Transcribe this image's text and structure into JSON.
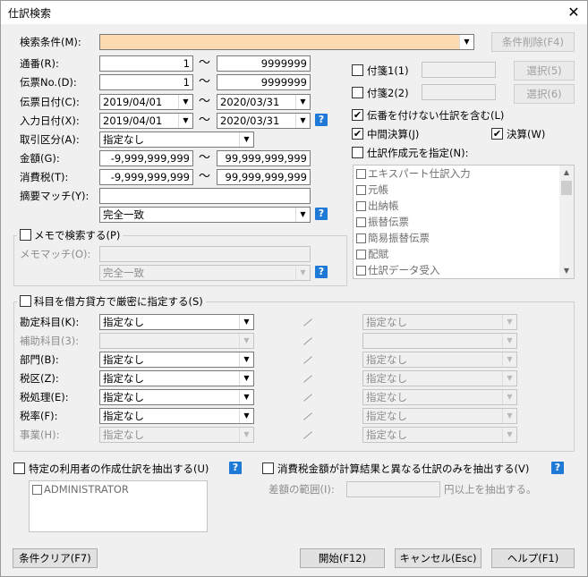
{
  "window": {
    "title": "仕訳検索"
  },
  "icons": {
    "close": "close-icon",
    "help": "help-icon",
    "dropdown": "chevron-down-icon"
  },
  "tilde": "～",
  "help_mark": "?",
  "check_mark": "✔",
  "search_condition": {
    "label": "検索条件(M):",
    "value": "",
    "accent": "#fddbb1"
  },
  "delete_condition_button": "条件削除(F4)",
  "serial": {
    "label": "通番(R):",
    "from": "1",
    "to": "9999999"
  },
  "voucher_no": {
    "label": "伝票No.(D):",
    "from": "1",
    "to": "9999999"
  },
  "voucher_date": {
    "label": "伝票日付(C):",
    "from": "2019/04/01",
    "to": "2020/03/31"
  },
  "input_date": {
    "label": "入力日付(X):",
    "from": "2019/04/01",
    "to": "2020/03/31"
  },
  "transaction_type": {
    "label": "取引区分(A):",
    "value": "指定なし"
  },
  "amount": {
    "label": "金額(G):",
    "from": "-9,999,999,999",
    "to": "99,999,999,999"
  },
  "tax": {
    "label": "消費税(T):",
    "from": "-9,999,999,999",
    "to": "99,999,999,999"
  },
  "summary_match": {
    "label": "摘要マッチ(Y):",
    "value": "",
    "mode": "完全一致"
  },
  "memo_search": {
    "label": "メモで検索する(P)",
    "match_label": "メモマッチ(O):",
    "value": "",
    "mode": "完全一致"
  },
  "sticky1": {
    "label": "付箋1(1)",
    "value": "",
    "select_button": "選択(5)"
  },
  "sticky2": {
    "label": "付箋2(2)",
    "value": "",
    "select_button": "選択(6)"
  },
  "include_unnumbered": {
    "label": "伝番を付けない仕訳を含む(L)",
    "checked": true
  },
  "interim_settlement": {
    "label": "中間決算(J)",
    "checked": true
  },
  "settlement": {
    "label": "決算(W)",
    "checked": true
  },
  "source": {
    "label": "仕訳作成元を指定(N):",
    "checked": false,
    "items": [
      "エキスパート仕訳入力",
      "元帳",
      "出納帳",
      "振替伝票",
      "簡易振替伝票",
      "配賦",
      "仕訳データ受入"
    ]
  },
  "strict_accounts": {
    "label": "科目を借方貸方で厳密に指定する(S)",
    "rows": [
      {
        "label": "勘定科目(K):",
        "debit": "指定なし",
        "credit": "指定なし",
        "enabled": true
      },
      {
        "label": "補助科目(3):",
        "debit": "",
        "credit": "",
        "enabled": false
      },
      {
        "label": "部門(B):",
        "debit": "指定なし",
        "credit": "指定なし",
        "enabled": true
      },
      {
        "label": "税区(Z):",
        "debit": "指定なし",
        "credit": "指定なし",
        "enabled": true
      },
      {
        "label": "税処理(E):",
        "debit": "指定なし",
        "credit": "指定なし",
        "enabled": true
      },
      {
        "label": "税率(F):",
        "debit": "指定なし",
        "credit": "指定なし",
        "enabled": true
      },
      {
        "label": "事業(H):",
        "debit": "指定なし",
        "credit": "指定なし",
        "enabled": false
      }
    ]
  },
  "specific_user": {
    "label": "特定の利用者の作成仕訳を抽出する(U)",
    "users": [
      "ADMINISTRATOR"
    ]
  },
  "tax_diff": {
    "label": "消費税金額が計算結果と異なる仕訳のみを抽出する(V)",
    "range_label": "差額の範囲(I):",
    "value": "",
    "suffix": "円以上を抽出する。"
  },
  "buttons": {
    "clear": "条件クリア(F7)",
    "start": "開始(F12)",
    "cancel": "キャンセル(Esc)",
    "help": "ヘルプ(F1)"
  }
}
